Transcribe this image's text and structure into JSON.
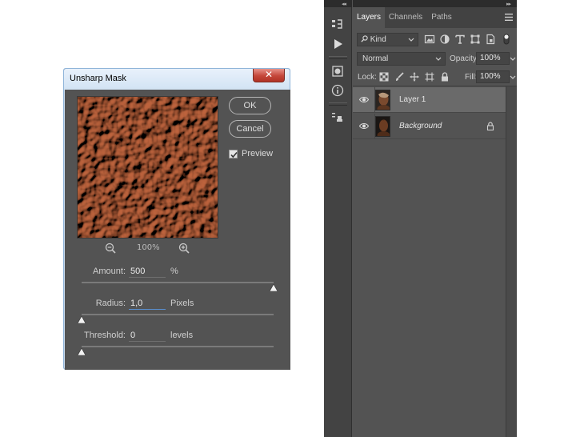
{
  "dialog": {
    "title": "Unsharp Mask",
    "close_label": "✕",
    "ok_label": "OK",
    "cancel_label": "Cancel",
    "preview_label": "Preview",
    "preview_checked": true,
    "zoom_value": "100%",
    "amount": {
      "label": "Amount:",
      "value": "500",
      "unit": "%",
      "slider_fraction": 1.0
    },
    "radius": {
      "label": "Radius:",
      "value": "1,0",
      "unit": "Pixels",
      "slider_fraction": 0.0
    },
    "threshold": {
      "label": "Threshold:",
      "value": "0",
      "unit": "levels",
      "slider_fraction": 0.0
    }
  },
  "panels": {
    "collapse_left": "◂◂",
    "collapse_right": "▸▸",
    "tabs": [
      {
        "label": "Layers",
        "active": true
      },
      {
        "label": "Channels",
        "active": false
      },
      {
        "label": "Paths",
        "active": false
      }
    ],
    "filter_kind": "Kind",
    "blend_mode": "Normal",
    "opacity_label": "Opacity:",
    "opacity_value": "100%",
    "lock_label": "Lock:",
    "fill_label": "Fill:",
    "fill_value": "100%",
    "layers": [
      {
        "name": "Layer 1",
        "selected": true,
        "visible": true,
        "locked": false
      },
      {
        "name": "Background",
        "selected": false,
        "visible": true,
        "locked": true
      }
    ]
  },
  "colors": {
    "panel_bg": "#535353",
    "dialog_title_bg": "#d2e3f4",
    "close_button": "#c4473a",
    "selected_layer": "#6a6a6a",
    "preview_texture": "#a0522d"
  }
}
